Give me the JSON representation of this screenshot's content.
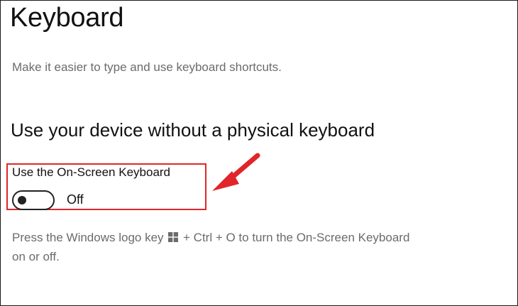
{
  "page": {
    "title": "Keyboard",
    "subtitle": "Make it easier to type and use keyboard shortcuts."
  },
  "section": {
    "heading": "Use your device without a physical keyboard"
  },
  "osk_setting": {
    "label": "Use the On-Screen Keyboard",
    "state_text": "Off",
    "is_on": false
  },
  "help": {
    "text_before_icon": "Press the Windows logo key",
    "icon": "windows-logo-icon",
    "text_after_icon": "+ Ctrl + O to turn the On-Screen Keyboard on or off."
  },
  "annotation": {
    "highlight_color": "#e0262a",
    "arrow_color": "#e0262a"
  },
  "colors": {
    "title": "#111111",
    "secondary_text": "#6b6b6b",
    "toggle": "#222222"
  }
}
